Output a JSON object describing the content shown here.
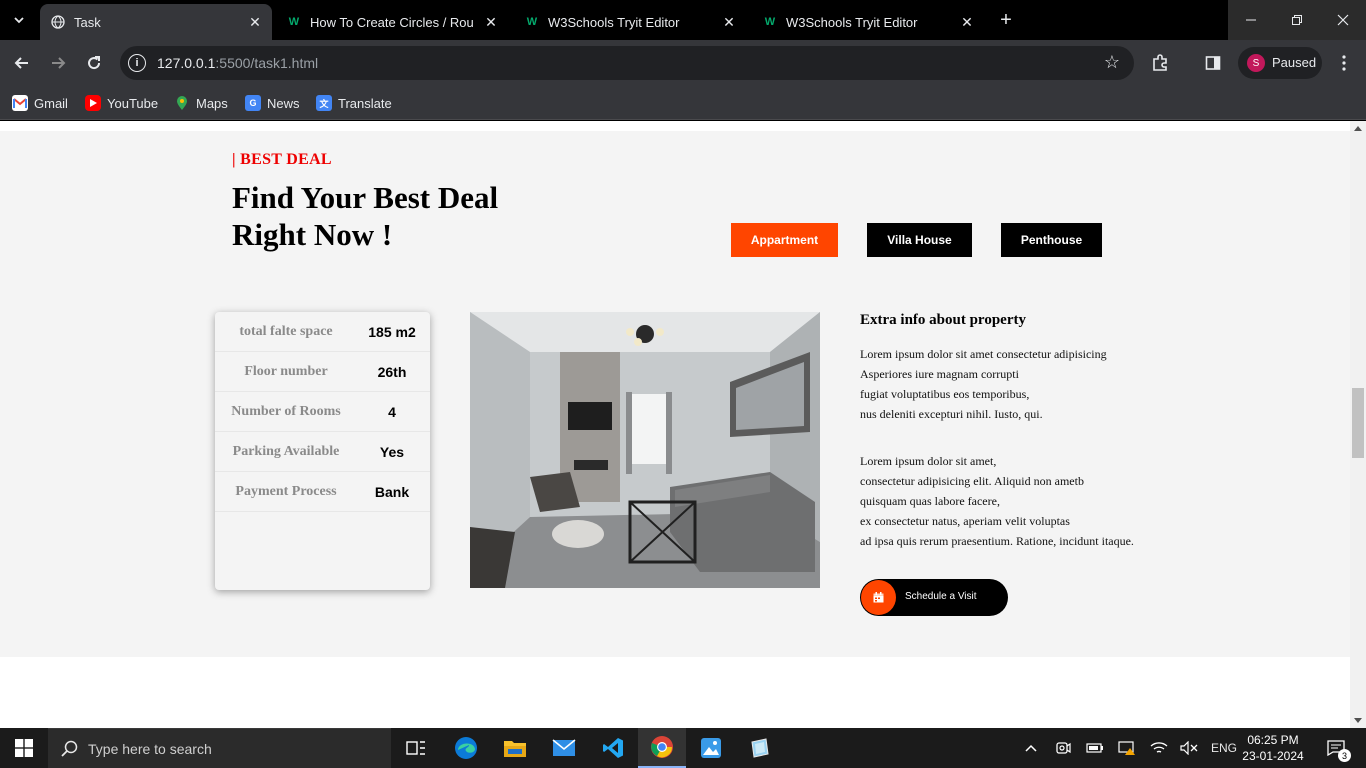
{
  "browser": {
    "tabs": [
      {
        "title": "Task",
        "icon": "globe-icon",
        "active": true
      },
      {
        "title": "How To Create Circles / Round D",
        "icon": "w3schools-icon",
        "active": false
      },
      {
        "title": "W3Schools Tryit Editor",
        "icon": "w3schools-icon",
        "active": false
      },
      {
        "title": "W3Schools Tryit Editor",
        "icon": "w3schools-icon",
        "active": false
      }
    ],
    "url_host": "127.0.0.1",
    "url_rest": ":5500/task1.html",
    "profile_initial": "S",
    "profile_label": "Paused",
    "bookmarks": [
      {
        "label": "Gmail",
        "icon": "gmail-icon"
      },
      {
        "label": "YouTube",
        "icon": "youtube-icon"
      },
      {
        "label": "Maps",
        "icon": "maps-icon"
      },
      {
        "label": "News",
        "icon": "news-icon"
      },
      {
        "label": "Translate",
        "icon": "translate-icon"
      }
    ]
  },
  "page": {
    "kicker": "| BEST DEAL",
    "headline": "Find Your Best Deal Right Now !",
    "filters": [
      {
        "label": "Appartment",
        "active": true
      },
      {
        "label": "Villa House",
        "active": false
      },
      {
        "label": "Penthouse",
        "active": false
      }
    ],
    "specs": [
      {
        "label": "total falte space",
        "value": "185 m2"
      },
      {
        "label": "Floor number",
        "value": "26th"
      },
      {
        "label": "Number of Rooms",
        "value": "4"
      },
      {
        "label": "Parking Available",
        "value": "Yes"
      },
      {
        "label": "Payment Process",
        "value": "Bank"
      }
    ],
    "photo_alt": "living-room-photo",
    "extra_title": "Extra info about property",
    "para1": "Lorem ipsum dolor sit amet consectetur adipisicing\nAsperiores iure magnam corrupti\nfugiat voluptatibus eos temporibus,\nnus deleniti excepturi nihil. Iusto, qui.",
    "para2": "Lorem ipsum dolor sit amet,\nconsectetur adipisicing elit. Aliquid non ametb\nquisquam quas labore facere,\nex consectetur natus, aperiam velit voluptas\nad ipsa quis rerum praesentium. Ratione, incidunt itaque.",
    "schedule_label": "Schedule a Visit",
    "accent_color": "#ff4500",
    "kicker_color": "#ee0000"
  },
  "taskbar": {
    "search_placeholder": "Type here to search",
    "apps": [
      "task-view-icon",
      "edge-icon",
      "file-explorer-icon",
      "mail-icon",
      "vscode-icon",
      "chrome-icon",
      "photos-icon",
      "app-icon"
    ],
    "language": "ENG",
    "time": "06:25 PM",
    "date": "23-01-2024",
    "notification_count": "3"
  }
}
